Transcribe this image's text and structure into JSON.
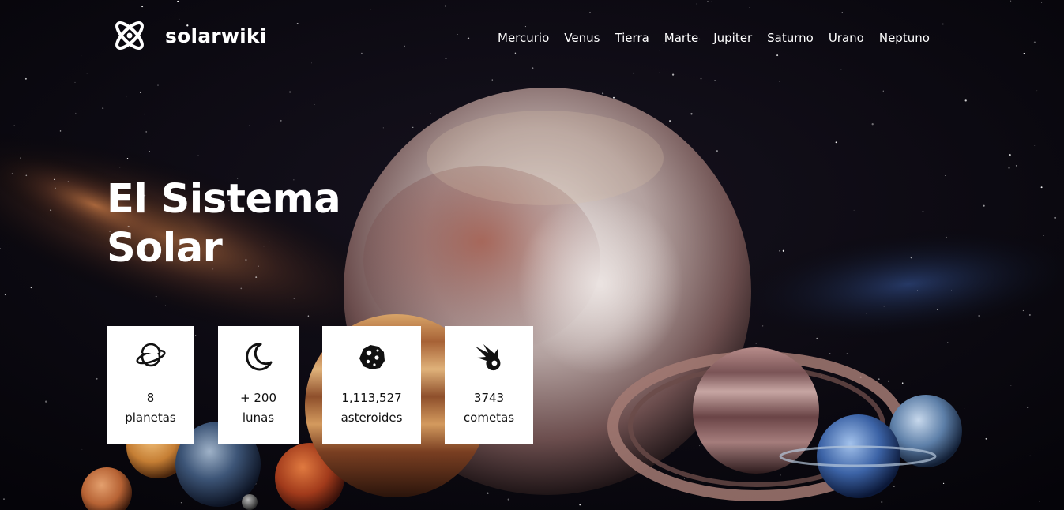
{
  "site": {
    "brand": "solarwiki"
  },
  "nav": {
    "items": [
      {
        "label": "Mercurio"
      },
      {
        "label": "Venus"
      },
      {
        "label": "Tierra"
      },
      {
        "label": "Marte"
      },
      {
        "label": "Jupiter"
      },
      {
        "label": "Saturno"
      },
      {
        "label": "Urano"
      },
      {
        "label": "Neptuno"
      }
    ]
  },
  "hero": {
    "title_line1": "El Sistema",
    "title_line2": "Solar",
    "stats": [
      {
        "icon": "planet-icon",
        "value": "8",
        "label": "planetas"
      },
      {
        "icon": "moon-icon",
        "value": "+ 200",
        "label": "lunas"
      },
      {
        "icon": "asteroid-icon",
        "value": "1,113,527",
        "label": "asteroides"
      },
      {
        "icon": "comet-icon",
        "value": "3743",
        "label": "cometas"
      }
    ]
  },
  "colors": {
    "background": "#07060d",
    "text": "#ffffff",
    "card_bg": "#ffffff",
    "card_text": "#111111"
  }
}
